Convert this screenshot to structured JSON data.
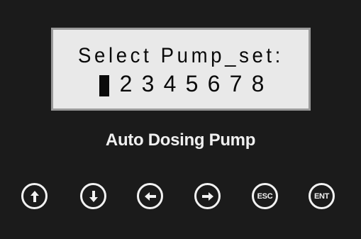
{
  "lcd": {
    "line1": "Select Pump_set:",
    "line2": {
      "cursor": "selected-cell",
      "digits": [
        "2",
        "3",
        "4",
        "5",
        "6",
        "7",
        "8"
      ]
    }
  },
  "brand": "Auto Dosing Pump",
  "buttons": [
    {
      "name": "up-button",
      "icon": "arrow-up-icon",
      "label": ""
    },
    {
      "name": "down-button",
      "icon": "arrow-down-icon",
      "label": ""
    },
    {
      "name": "left-button",
      "icon": "arrow-left-icon",
      "label": ""
    },
    {
      "name": "right-button",
      "icon": "arrow-right-icon",
      "label": ""
    },
    {
      "name": "esc-button",
      "icon": "",
      "label": "ESC"
    },
    {
      "name": "ent-button",
      "icon": "",
      "label": "ENT"
    }
  ],
  "colors": {
    "panel": "#1b1b1b",
    "lcd_background": "#e9e9e9",
    "lcd_border": "#9a9a9a",
    "lcd_text": "#0a0a0a",
    "button_outline": "#f2f2f2"
  }
}
